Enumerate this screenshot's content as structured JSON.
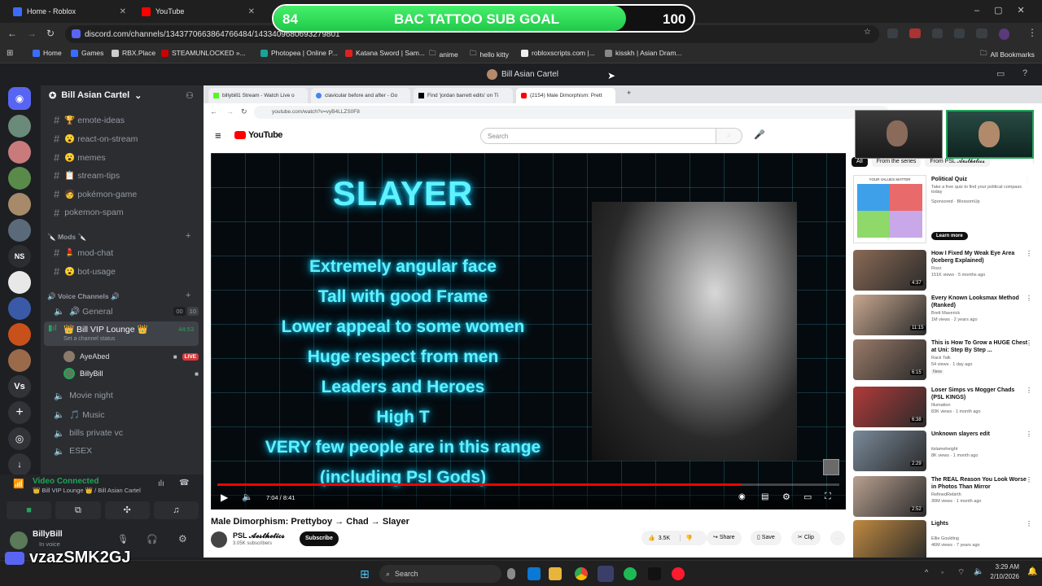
{
  "browser": {
    "tabs": [
      {
        "label": "Home - Roblox"
      },
      {
        "label": "YouTube"
      }
    ],
    "url": "discord.com/channels/1343770663864766484/1433409680693279801",
    "bookmarks": [
      "Home",
      "Games",
      "RBX.Place",
      "STEAMUNLOCKED »...",
      "Photopea | Online P...",
      "Katana Sword | Sam...",
      "anime",
      "hello kitty",
      "robloxscripts.com |...",
      "kisskh | Asian Dram..."
    ],
    "all_bookmarks": "All Bookmarks"
  },
  "goal": {
    "current": "84",
    "label": "BAC TATTOO SUB GOAL",
    "target": "100",
    "progress": 0.84
  },
  "discord": {
    "window_title": "Bill Asian Cartel",
    "server_name": "Bill Asian Cartel",
    "server_acronym": "NS",
    "vs_label": "Vs",
    "channels": [
      {
        "label": "🏆 emote-ideas"
      },
      {
        "label": "😮 react-on-stream"
      },
      {
        "label": "😮 memes"
      },
      {
        "label": "📋 stream-tips"
      },
      {
        "label": "🧑 pokémon-game"
      },
      {
        "label": "pokemon-spam"
      }
    ],
    "mods_category": "🔪 Mods 🔪",
    "mod_channels": [
      {
        "label": "💄 mod-chat"
      },
      {
        "label": "😮 bot-usage"
      }
    ],
    "voice_category": "🔊 Voice Channels 🔊",
    "voice_channels": [
      {
        "label": "🔊 General",
        "counts": [
          "00",
          "10"
        ]
      },
      {
        "label": "👑 Bill VIP Lounge 👑",
        "time": "44:53",
        "status": "Set a channel status"
      },
      {
        "label": "Movie night"
      },
      {
        "label": "🎵 Music"
      },
      {
        "label": "bills private vc"
      },
      {
        "label": "ESEX"
      }
    ],
    "members": [
      {
        "name": "AyeAbed",
        "badge": "LIVE"
      },
      {
        "name": "BillyBill"
      }
    ],
    "voice_connected": "Video Connected",
    "voice_location": "👑 Bill VIP Lounge 👑 / Bill Asian Cartel",
    "user": {
      "name": "BillyBill",
      "status": "In voice"
    },
    "watermark": "vzazSMK2GJ"
  },
  "stream": {
    "tabs": [
      "billybill1 Stream - Watch Live o",
      "clavicular before and after - Go",
      "Find 'jordan barrett edits' on Ti",
      "(2154) Male Dimorphism: Prett"
    ],
    "url": "youtube.com/watch?v=vyB4LLZS0F8",
    "search_placeholder": "Search",
    "video": {
      "heading": "SLAYER",
      "lines": [
        "Extremely angular face",
        "Tall with good Frame",
        "Lower appeal to some women",
        "Huge respect from men",
        "Leaders and Heroes",
        "High T",
        "VERY few people are in this range",
        "(including Psl Gods)"
      ],
      "time": "7:04 / 8:41",
      "progress": 0.843
    },
    "title": "Male Dimorphism: Prettyboy → Chad → Slayer",
    "channel": {
      "name": "PSL 𝓐𝓮𝓼𝓽𝓱𝓮𝓽𝓲𝓬𝓼",
      "subs": "3.05K subscribers"
    },
    "subscribe": "Subscribe",
    "actions": {
      "likes": "3.5K",
      "share": "Share",
      "save": "Save",
      "clip": "Clip"
    },
    "filters": [
      "All",
      "From the series",
      "From PSL 𝓐𝓮𝓼𝓽𝓱𝓮𝓽𝓲𝓬𝓼"
    ],
    "ad": {
      "title": "Political Quiz",
      "desc": "Take a free quiz to find your political compass today",
      "sponsor": "Sponsored · BlossomUp",
      "cta": "Learn more",
      "thumb_text": "YOUR VALUES MATTER"
    },
    "recommendations": [
      {
        "title": "How I Fixed My Weak Eye Area (Iceberg Explained)",
        "channel": "Rozz",
        "views": "151K views · 5 months ago",
        "duration": "4:37",
        "thumb": "#8a6a55"
      },
      {
        "title": "Every Known Looksmax Method (Ranked)",
        "channel": "Brett Maverick",
        "views": "1M views · 2 years ago",
        "duration": "11:15",
        "thumb": "#c8a890"
      },
      {
        "title": "This is How To Grow a HUGE Chest at Uni: Step By Step ...",
        "channel": "Rack Talk",
        "views": "54 views · 1 day ago",
        "duration": "6:15",
        "thumb": "#9a7a68",
        "tag": "New"
      },
      {
        "title": "Loser Simps vs Mogger Chads (PSL KINGS)",
        "channel": "Illumation",
        "views": "83K views · 1 month ago",
        "duration": "6:38",
        "thumb": "#b23a3a"
      },
      {
        "title": "Unknown slayers edit",
        "channel": "itslameheight",
        "views": "8K views · 1 month ago",
        "duration": "2:29",
        "thumb": "#7a8a9a"
      },
      {
        "title": "The REAL Reason You Look Worse in Photos Than Mirror",
        "channel": "RefinedRebirth",
        "views": "30M views · 1 month ago",
        "duration": "2:52",
        "thumb": "#b8a090"
      },
      {
        "title": "Lights",
        "channel": "Ellie Goulding",
        "views": "46M views · 7 years ago",
        "duration": "",
        "thumb": "#c08a40"
      }
    ]
  },
  "taskbar": {
    "search": "Search",
    "time": "3:29 AM",
    "date": "2/10/2026"
  }
}
